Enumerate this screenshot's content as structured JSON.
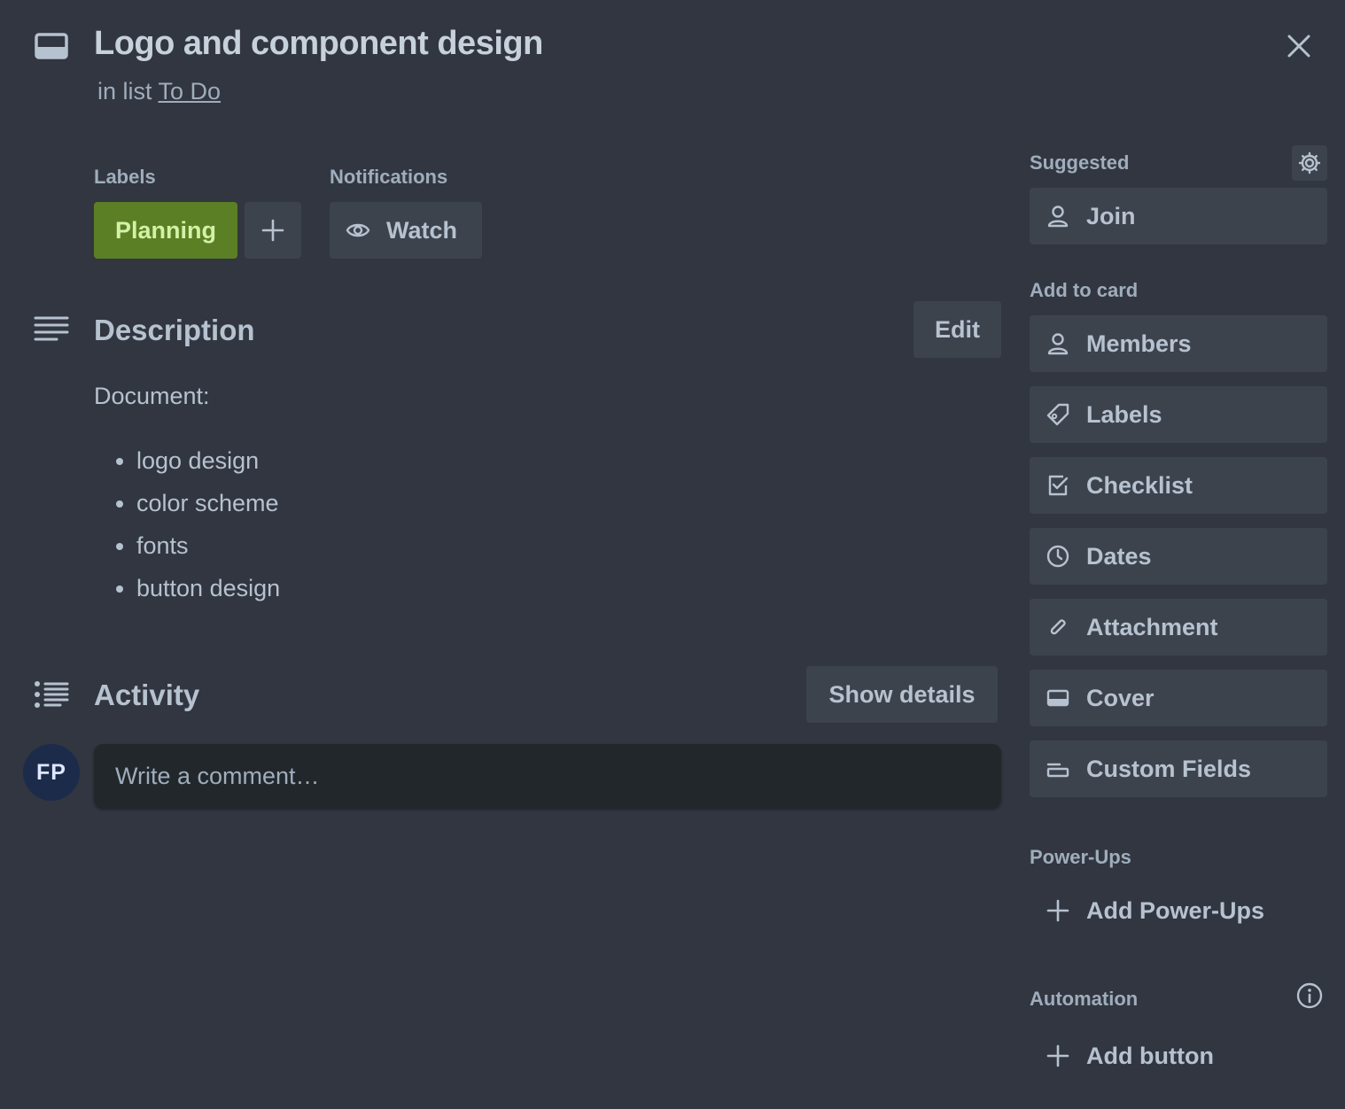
{
  "card": {
    "title": "Logo and component design",
    "subtitle_prefix": "in list",
    "list_name": "To Do",
    "close_icon": "close-icon"
  },
  "labels_section": {
    "heading": "Labels",
    "label_text": "Planning",
    "label_color": "#5b7f24"
  },
  "notifications_section": {
    "heading": "Notifications",
    "watch_label": "Watch"
  },
  "description": {
    "title": "Description",
    "edit_label": "Edit",
    "intro": "Document:",
    "items": [
      "logo design",
      "color scheme",
      "fonts",
      "button design"
    ]
  },
  "activity": {
    "title": "Activity",
    "show_details_label": "Show details",
    "avatar_initials": "FP",
    "comment_placeholder": "Write a comment…"
  },
  "sidebar": {
    "suggested_heading": "Suggested",
    "join_label": "Join",
    "add_to_card_heading": "Add to card",
    "add_to_card": [
      {
        "label": "Members",
        "icon": "person-icon"
      },
      {
        "label": "Labels",
        "icon": "tag-icon"
      },
      {
        "label": "Checklist",
        "icon": "checklist-icon"
      },
      {
        "label": "Dates",
        "icon": "clock-icon"
      },
      {
        "label": "Attachment",
        "icon": "paperclip-icon"
      },
      {
        "label": "Cover",
        "icon": "cover-icon"
      },
      {
        "label": "Custom Fields",
        "icon": "custom-fields-icon"
      }
    ],
    "power_ups_heading": "Power-Ups",
    "add_power_ups_label": "Add Power-Ups",
    "automation_heading": "Automation",
    "add_button_label": "Add button"
  },
  "colors": {
    "background": "#323640",
    "button": "#3d434d",
    "label_green": "#5b7f24",
    "comment_bg": "#22272b",
    "avatar_bg": "#1c2b4a"
  }
}
